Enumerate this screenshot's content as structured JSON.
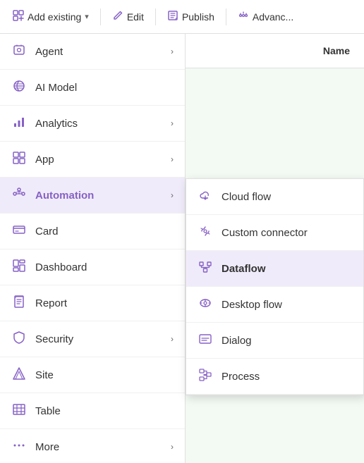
{
  "toolbar": {
    "add_existing_label": "Add existing",
    "edit_label": "Edit",
    "publish_label": "Publish",
    "advance_label": "Advanc..."
  },
  "sidebar": {
    "items": [
      {
        "id": "agent",
        "label": "Agent",
        "hasArrow": true,
        "icon": "agent"
      },
      {
        "id": "ai-model",
        "label": "AI Model",
        "hasArrow": false,
        "icon": "ai-model"
      },
      {
        "id": "analytics",
        "label": "Analytics",
        "hasArrow": true,
        "icon": "analytics"
      },
      {
        "id": "app",
        "label": "App",
        "hasArrow": true,
        "icon": "app"
      },
      {
        "id": "automation",
        "label": "Automation",
        "hasArrow": true,
        "icon": "automation",
        "active": true
      },
      {
        "id": "card",
        "label": "Card",
        "hasArrow": false,
        "icon": "card"
      },
      {
        "id": "dashboard",
        "label": "Dashboard",
        "hasArrow": false,
        "icon": "dashboard"
      },
      {
        "id": "report",
        "label": "Report",
        "hasArrow": false,
        "icon": "report"
      },
      {
        "id": "security",
        "label": "Security",
        "hasArrow": true,
        "icon": "security"
      },
      {
        "id": "site",
        "label": "Site",
        "hasArrow": false,
        "icon": "site"
      },
      {
        "id": "table",
        "label": "Table",
        "hasArrow": false,
        "icon": "table"
      },
      {
        "id": "more",
        "label": "More",
        "hasArrow": true,
        "icon": "more"
      }
    ]
  },
  "submenu": {
    "items": [
      {
        "id": "cloud-flow",
        "label": "Cloud flow",
        "icon": "cloud-flow",
        "highlighted": false
      },
      {
        "id": "custom-connector",
        "label": "Custom connector",
        "icon": "custom-connector",
        "highlighted": false
      },
      {
        "id": "dataflow",
        "label": "Dataflow",
        "icon": "dataflow",
        "highlighted": true
      },
      {
        "id": "desktop-flow",
        "label": "Desktop flow",
        "icon": "desktop-flow",
        "highlighted": false
      },
      {
        "id": "dialog",
        "label": "Dialog",
        "icon": "dialog",
        "highlighted": false
      },
      {
        "id": "process",
        "label": "Process",
        "icon": "process",
        "highlighted": false
      }
    ]
  },
  "content": {
    "column_name": "Name"
  },
  "colors": {
    "purple": "#8661c5",
    "purple_light": "#f0ebfa"
  }
}
